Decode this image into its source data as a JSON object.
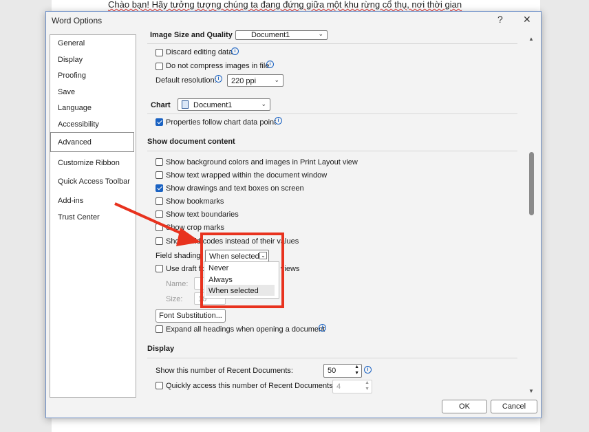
{
  "background": {
    "doc_text": "Chào bạn! Hãy tưởng tượng chúng ta đang đứng giữa một khu rừng cổ thụ, nơi thời gian"
  },
  "dialog": {
    "title": "Word Options",
    "help_glyph": "?",
    "close_glyph": "✕"
  },
  "nav": {
    "items": [
      "General",
      "Display",
      "Proofing",
      "Save",
      "Language",
      "Accessibility",
      "Advanced",
      "Customize Ribbon",
      "Quick Access Toolbar",
      "Add-ins",
      "Trust Center"
    ],
    "selected": "Advanced"
  },
  "image_quality": {
    "label": "Image Size and Quality",
    "doc": "Document1",
    "discard_label": "Discard editing data",
    "discard_checked": false,
    "nocompress_label": "Do not compress images in file",
    "nocompress_checked": false,
    "resolution_label": "Default resolution:",
    "resolution_value": "220 ppi"
  },
  "chart": {
    "label": "Chart",
    "doc": "Document1",
    "follow_label": "Properties follow chart data point",
    "follow_checked": true
  },
  "show_doc": {
    "title": "Show document content",
    "items": [
      {
        "label": "Show background colors and images in Print Layout view",
        "checked": false
      },
      {
        "label": "Show text wrapped within the document window",
        "checked": false
      },
      {
        "label": "Show drawings and text boxes on screen",
        "checked": true
      },
      {
        "label": "Show bookmarks",
        "checked": false
      },
      {
        "label": "Show text boundaries",
        "checked": false
      },
      {
        "label": "Show crop marks",
        "checked": false
      },
      {
        "label": "Show field codes instead of their values",
        "checked": false
      }
    ],
    "field_shading_label": "Field shading:",
    "field_shading_value": "When selected",
    "field_shading_options": [
      "Never",
      "Always",
      "When selected"
    ],
    "draft_label": "Use draft font in Draft and Outline views",
    "draft_checked": false,
    "name_label": "Name:",
    "size_label": "Size:",
    "size_value": "10",
    "font_sub_label": "Font Substitution...",
    "expand_label": "Expand all headings when opening a document",
    "expand_checked": false
  },
  "display": {
    "title": "Display",
    "recent_docs_label": "Show this number of Recent Documents:",
    "recent_docs_value": "50",
    "quick_access_label": "Quickly access this number of Recent Documents:",
    "quick_access_value": "4",
    "quick_access_checked": false
  },
  "buttons": {
    "ok": "OK",
    "cancel": "Cancel"
  },
  "colors": {
    "accent": "#1a62c2",
    "annotation": "#e8321e"
  },
  "icons": [
    "help-icon",
    "close-icon",
    "info-icon",
    "document-icon",
    "chevron-down-icon",
    "spin-up-icon",
    "spin-down-icon",
    "arrow-annotation"
  ]
}
